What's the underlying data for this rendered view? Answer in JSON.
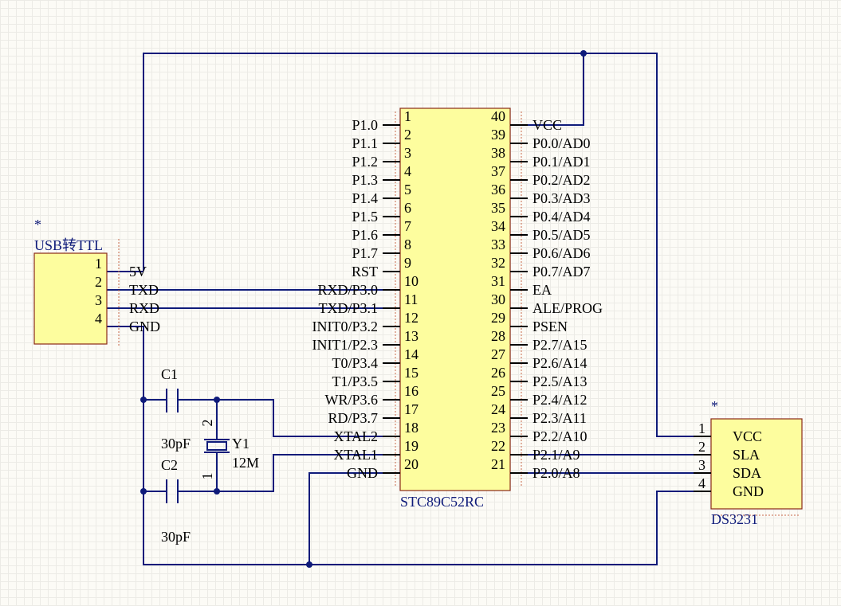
{
  "mcu": {
    "name": "STC89C52RC",
    "left_pins": [
      {
        "num": "1",
        "label": "P1.0"
      },
      {
        "num": "2",
        "label": "P1.1"
      },
      {
        "num": "3",
        "label": "P1.2"
      },
      {
        "num": "4",
        "label": "P1.3"
      },
      {
        "num": "5",
        "label": "P1.4"
      },
      {
        "num": "6",
        "label": "P1.5"
      },
      {
        "num": "7",
        "label": "P1.6"
      },
      {
        "num": "8",
        "label": "P1.7"
      },
      {
        "num": "9",
        "label": "RST"
      },
      {
        "num": "10",
        "label": "RXD/P3.0"
      },
      {
        "num": "11",
        "label": "TXD/P3.1"
      },
      {
        "num": "12",
        "label": "INIT0/P3.2"
      },
      {
        "num": "13",
        "label": "INIT1/P2.3"
      },
      {
        "num": "14",
        "label": "T0/P3.4"
      },
      {
        "num": "15",
        "label": "T1/P3.5"
      },
      {
        "num": "16",
        "label": "WR/P3.6"
      },
      {
        "num": "17",
        "label": "RD/P3.7"
      },
      {
        "num": "18",
        "label": "XTAL2"
      },
      {
        "num": "19",
        "label": "XTAL1"
      },
      {
        "num": "20",
        "label": "GND"
      }
    ],
    "right_pins": [
      {
        "num": "40",
        "label": "VCC"
      },
      {
        "num": "39",
        "label": "P0.0/AD0"
      },
      {
        "num": "38",
        "label": "P0.1/AD1"
      },
      {
        "num": "37",
        "label": "P0.2/AD2"
      },
      {
        "num": "36",
        "label": "P0.3/AD3"
      },
      {
        "num": "35",
        "label": "P0.4/AD4"
      },
      {
        "num": "34",
        "label": "P0.5/AD5"
      },
      {
        "num": "33",
        "label": "P0.6/AD6"
      },
      {
        "num": "32",
        "label": "P0.7/AD7"
      },
      {
        "num": "31",
        "label": "EA"
      },
      {
        "num": "30",
        "label": "ALE/PROG"
      },
      {
        "num": "29",
        "label": "PSEN"
      },
      {
        "num": "28",
        "label": "P2.7/A15"
      },
      {
        "num": "27",
        "label": "P2.6/A14"
      },
      {
        "num": "26",
        "label": "P2.5/A13"
      },
      {
        "num": "25",
        "label": "P2.4/A12"
      },
      {
        "num": "24",
        "label": "P2.3/A11"
      },
      {
        "num": "23",
        "label": "P2.2/A10"
      },
      {
        "num": "22",
        "label": "P2.1/A9"
      },
      {
        "num": "21",
        "label": "P2.0/A8"
      }
    ]
  },
  "usb": {
    "name": "USB转TTL",
    "star": "*",
    "pins": [
      {
        "num": "1",
        "label": "5V"
      },
      {
        "num": "2",
        "label": "TXD"
      },
      {
        "num": "3",
        "label": "RXD"
      },
      {
        "num": "4",
        "label": "GND"
      }
    ]
  },
  "rtc": {
    "name": "DS3231",
    "star": "*",
    "pins": [
      {
        "num": "1",
        "label": "VCC"
      },
      {
        "num": "2",
        "label": "SLA"
      },
      {
        "num": "3",
        "label": "SDA"
      },
      {
        "num": "4",
        "label": "GND"
      }
    ]
  },
  "c1": {
    "name": "C1",
    "value": "30pF"
  },
  "c2": {
    "name": "C2",
    "value": "30pF"
  },
  "y1": {
    "name": "Y1",
    "value": "12M",
    "pin_top": "2",
    "pin_bottom": "1"
  }
}
